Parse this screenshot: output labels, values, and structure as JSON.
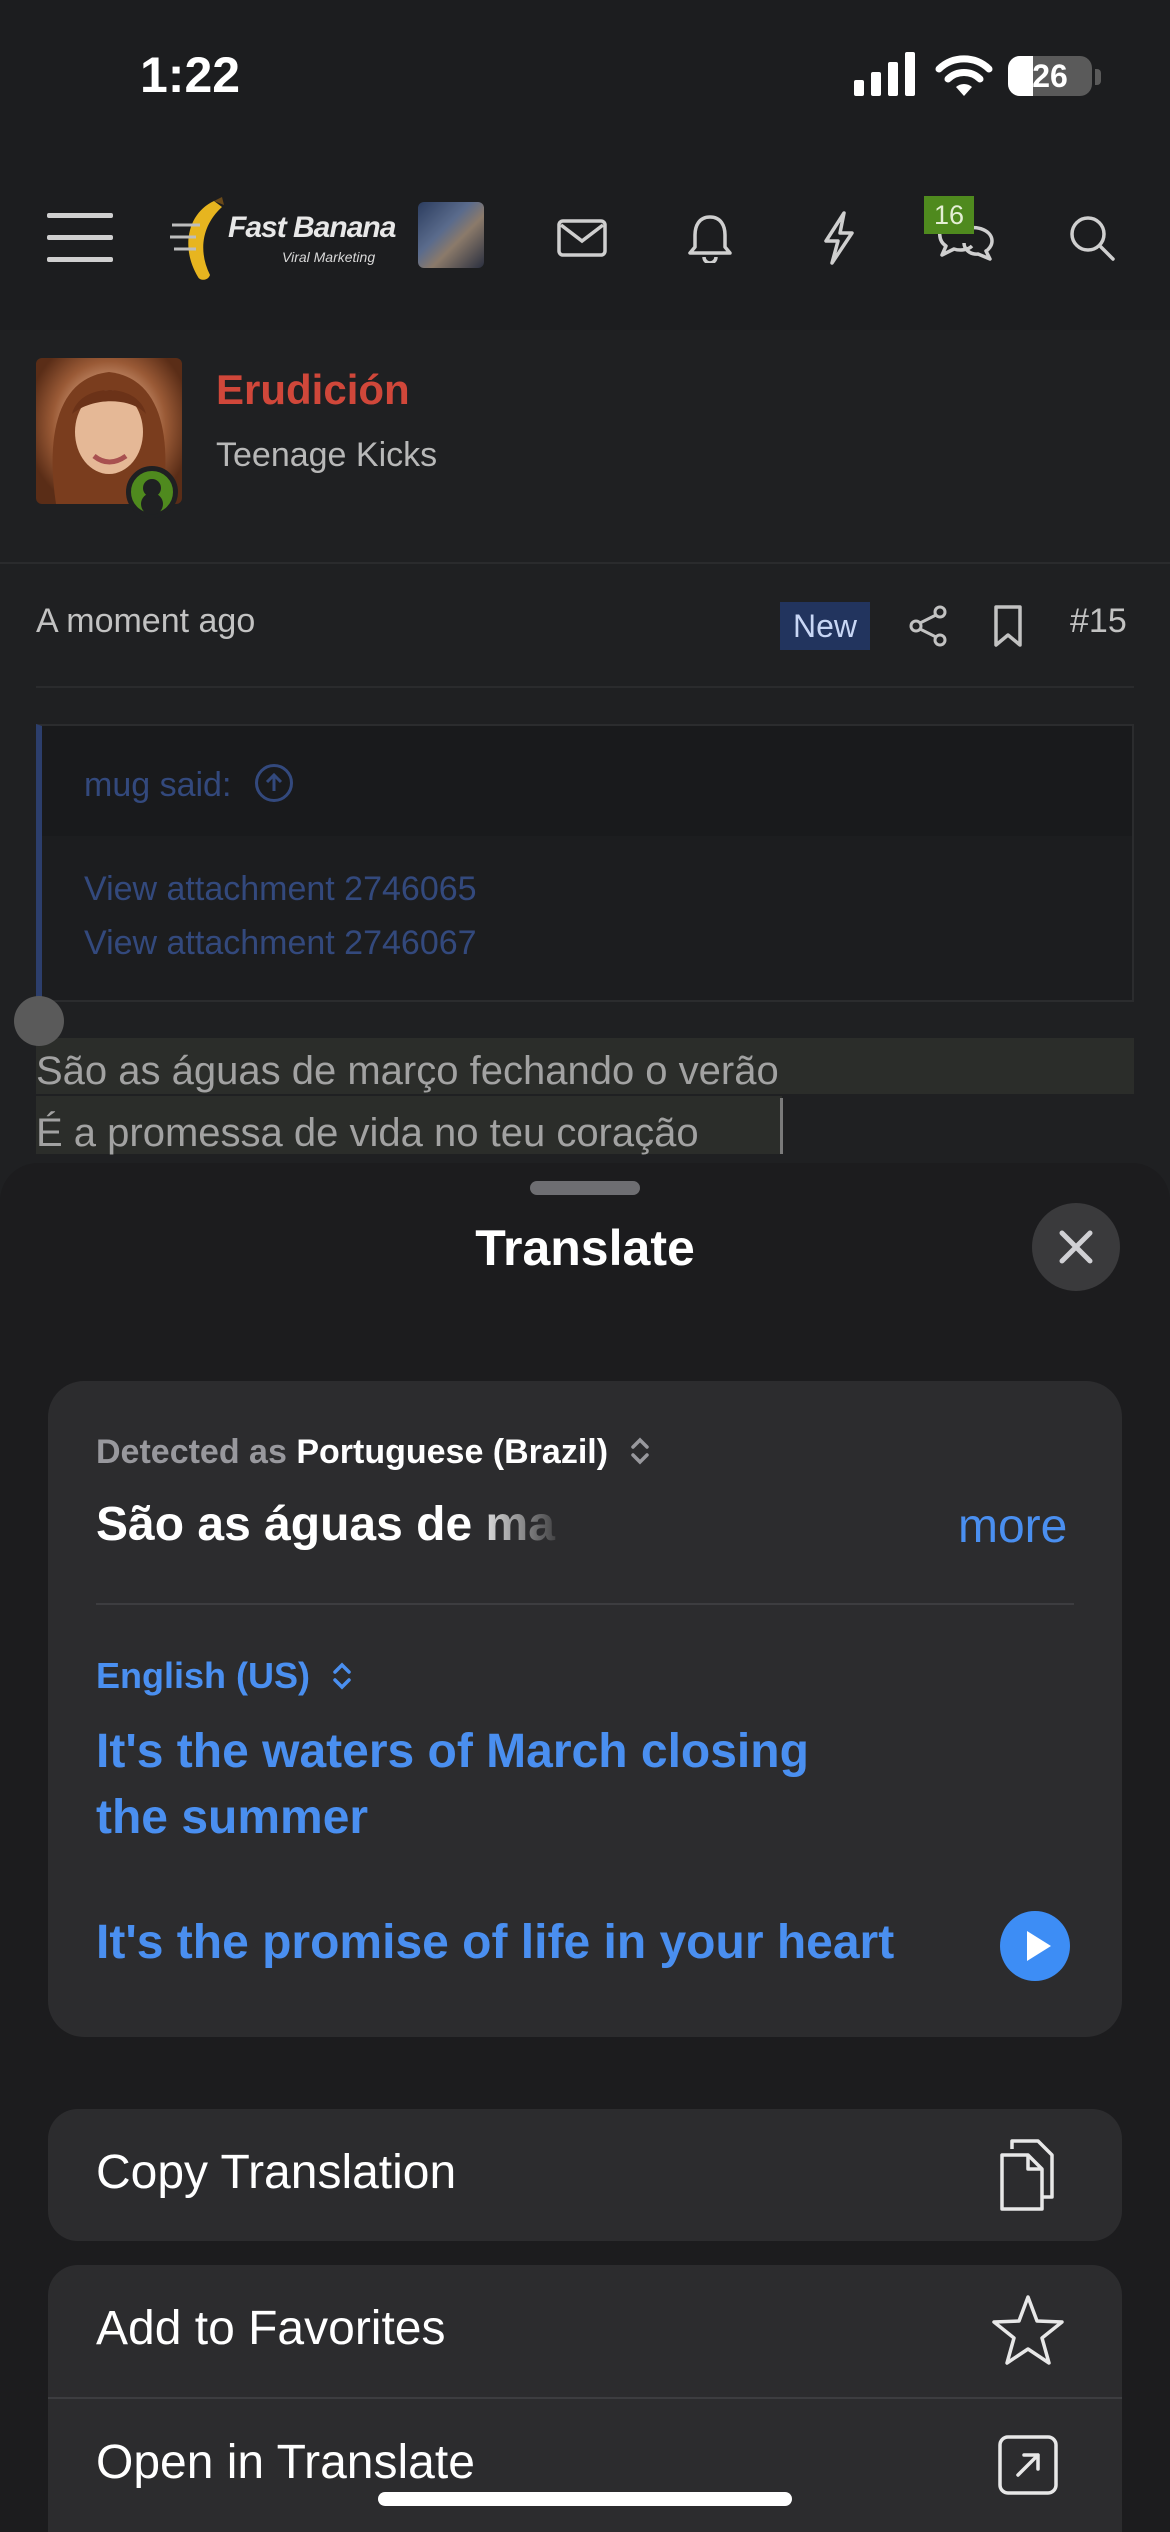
{
  "status_bar": {
    "time": "1:22",
    "battery": "26"
  },
  "header": {
    "logo_title": "Fast Banana",
    "logo_subtitle": "Viral Marketing",
    "conversations_badge": "16",
    "icons": [
      "menu-icon",
      "mail-icon",
      "bell-icon",
      "bolt-icon",
      "chat-icon",
      "search-icon"
    ]
  },
  "post": {
    "username": "Erudición",
    "user_title": "Teenage Kicks",
    "time": "A moment ago",
    "new_badge": "New",
    "number": "#15",
    "quote": {
      "author": "mug said:",
      "attachments": [
        "View attachment 2746065",
        "View attachment 2746067"
      ]
    },
    "lines": [
      "São as águas de março fechando o verão",
      "É a promessa de vida no teu coração"
    ]
  },
  "translate": {
    "title": "Translate",
    "detected_prefix": "Detected as",
    "source_language": "Portuguese (Brazil)",
    "source_text": "São as águas de março fechando o verão",
    "more_label": "more",
    "target_language": "English (US)",
    "translation_line1": "It's the waters of March closing the summer",
    "translation_line2": "It's the promise of life in your heart",
    "actions": [
      {
        "label": "Copy Translation",
        "icon": "copy-icon"
      },
      {
        "label": "Add to Favorites",
        "icon": "star-icon"
      },
      {
        "label": "Open in Translate",
        "icon": "open-external-icon"
      }
    ]
  },
  "colors": {
    "accent_blue": "#4a8ff0",
    "username_red": "#d0473a",
    "online_green": "#4f8a1e",
    "sheet_bg": "#1c1c1e",
    "card_bg": "#2c2c2e"
  }
}
